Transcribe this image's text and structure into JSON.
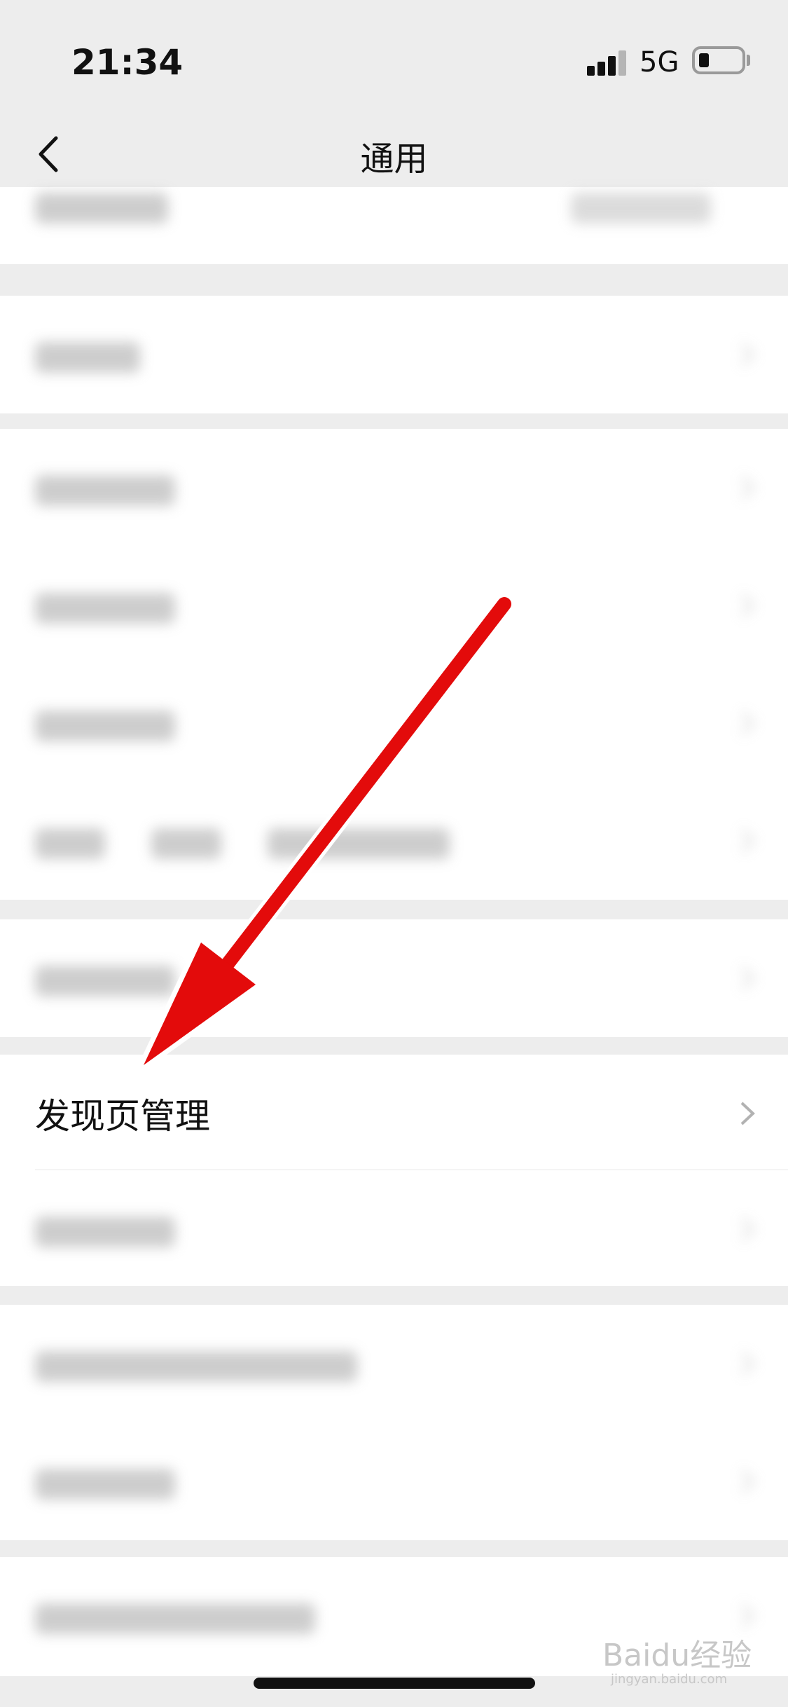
{
  "status_bar": {
    "time": "21:34",
    "network": "5G"
  },
  "nav": {
    "title": "通用"
  },
  "focus_item": {
    "label": "发现页管理"
  },
  "watermark": {
    "text": "Baidu经验",
    "sub": "jingyan.baidu.com"
  }
}
